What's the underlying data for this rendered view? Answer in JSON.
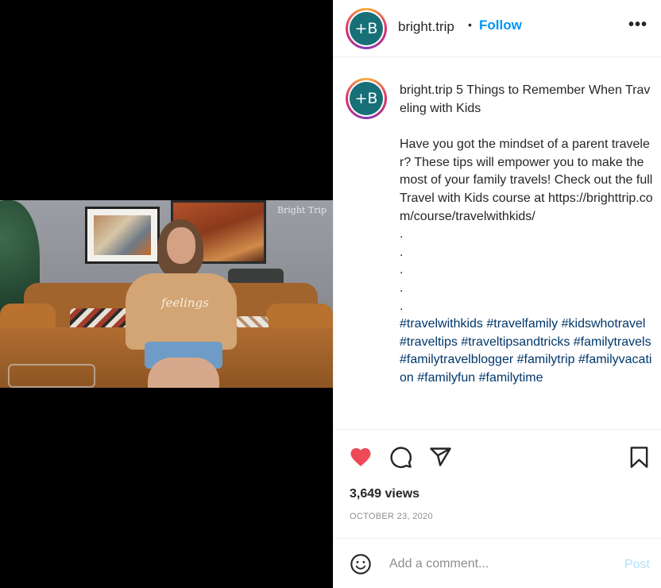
{
  "media": {
    "watermark": "Bright Trip",
    "sweater_text": "feelings"
  },
  "header": {
    "avatar_text": "+B",
    "username": "bright.trip",
    "separator": "•",
    "follow_label": "Follow",
    "more_label": "•••"
  },
  "caption": {
    "avatar_text": "+B",
    "username": "bright.trip",
    "title": "5 Things to Remember When Traveling with Kids",
    "body": "Have you got the mindset of a parent traveler? These tips will empower you to make the most of your family travels! Check out the full Travel with Kids course at https://brighttrip.com/course/travelwithkids/",
    "dots": ".\n.\n.\n.\n.",
    "hashtags": "#travelwithkids #travelfamily #kidswhotravel #traveltips #traveltipsandtricks #familytravels #familytravelblogger #familytrip #familyvacation #familyfun #familytime"
  },
  "actions": {
    "like_icon": "heart-icon",
    "comment_icon": "comment-icon",
    "share_icon": "share-icon",
    "save_icon": "bookmark-icon",
    "like_color": "#ed4956"
  },
  "stats": {
    "views": "3,649 views",
    "date": "OCTOBER 23, 2020"
  },
  "comment": {
    "emoji_icon": "smiley-icon",
    "placeholder": "Add a comment...",
    "post_label": "Post"
  }
}
